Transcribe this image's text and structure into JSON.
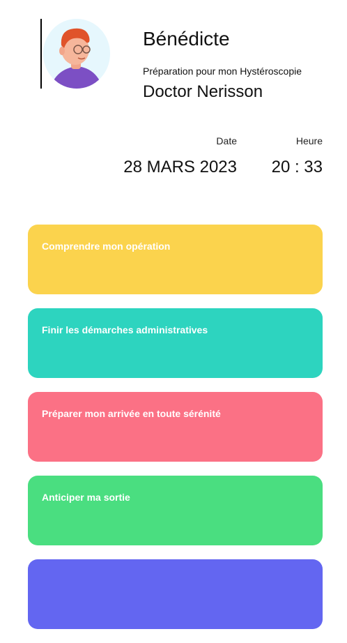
{
  "patient": {
    "name": "Bénédicte",
    "preparation": "Préparation pour mon Hystéroscopie",
    "doctor": "Doctor Nerisson"
  },
  "appointment": {
    "date_label": "Date",
    "time_label": "Heure",
    "date_value": "28 MARS 2023",
    "time_value": "20 : 33"
  },
  "cards": [
    {
      "label": "Comprendre mon opération",
      "color": "#fbd34d"
    },
    {
      "label": "Finir les démarches administratives",
      "color": "#2dd4bf"
    },
    {
      "label": "Préparer mon arrivée en toute sérénité",
      "color": "#fb7185"
    },
    {
      "label": "Anticiper ma sortie",
      "color": "#4ade80"
    },
    {
      "label": "",
      "color": "#6366f1"
    }
  ],
  "icons": {
    "avatar": "person-avatar-icon"
  }
}
